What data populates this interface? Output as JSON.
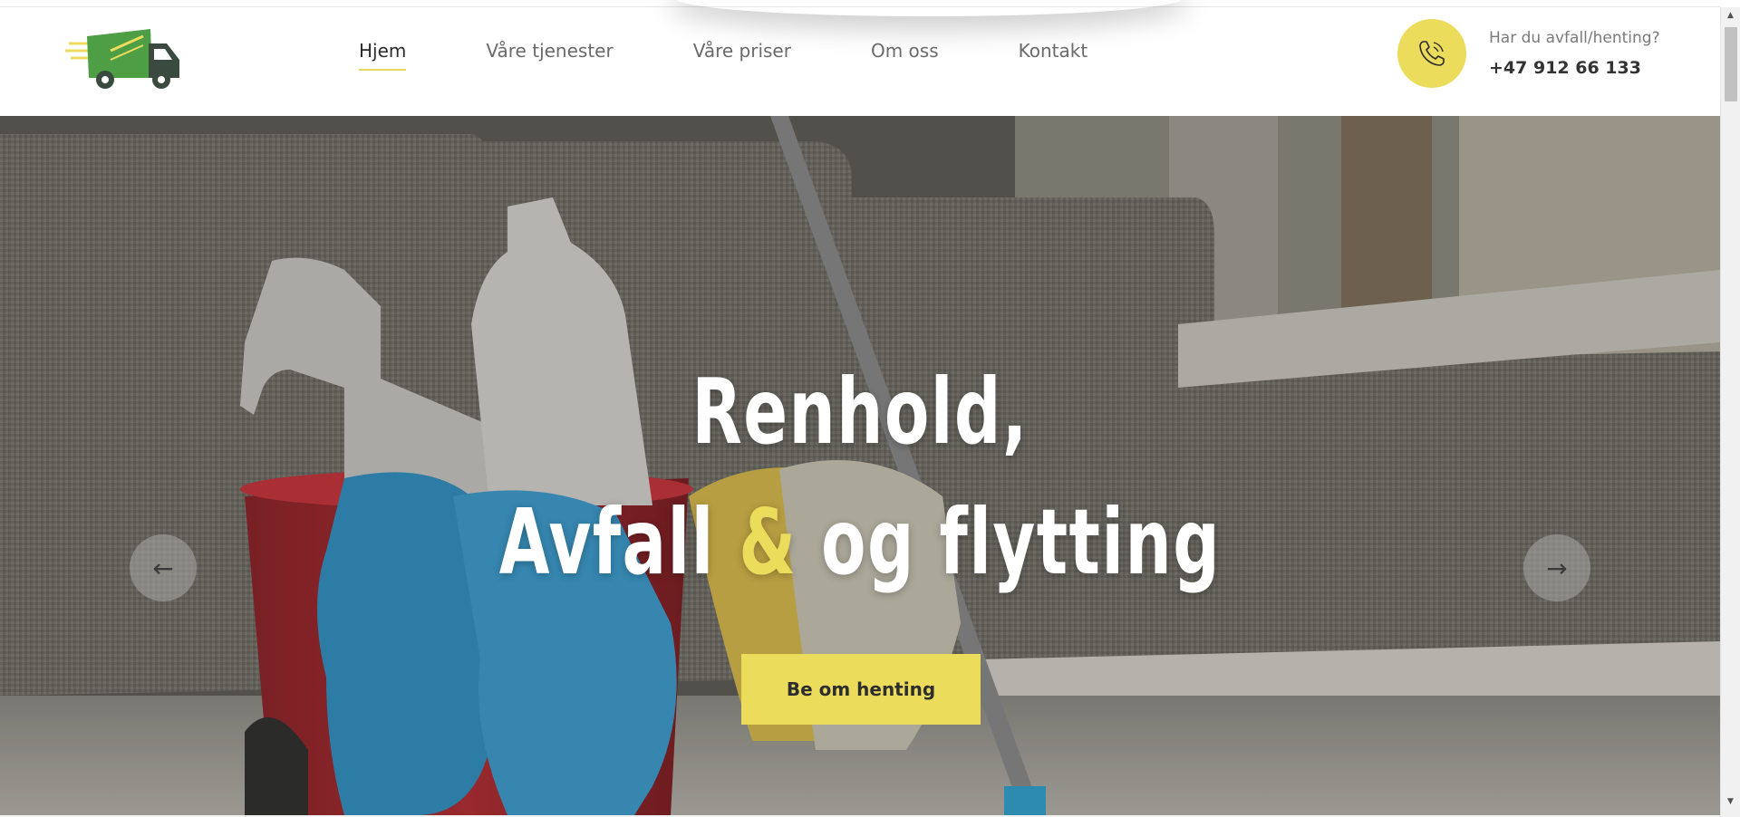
{
  "header": {
    "nav": [
      {
        "label": "Hjem",
        "active": true
      },
      {
        "label": "Våre tjenester",
        "active": false
      },
      {
        "label": "Våre priser",
        "active": false
      },
      {
        "label": "Om oss",
        "active": false
      },
      {
        "label": "Kontakt",
        "active": false
      }
    ],
    "contact_question": "Har du avfall/henting?",
    "contact_phone": "+47 912 66 133",
    "logo_icon": "delivery-truck-icon",
    "phone_icon": "phone-icon"
  },
  "hero": {
    "title_line1": "Renhold,",
    "title_line2_before": "Avfall",
    "title_line2_amp": "&",
    "title_line2_after": "og flytting",
    "cta_label": "Be om henting",
    "prev_icon": "arrow-left-icon",
    "next_icon": "arrow-right-icon",
    "prev_glyph": "←",
    "next_glyph": "→"
  },
  "colors": {
    "accent_yellow": "#ECDC5C",
    "logo_green": "#4E9E46",
    "logo_dark": "#3B4A3E",
    "nav_text": "#6A6A6A",
    "nav_active_text": "#2A2A2A"
  }
}
